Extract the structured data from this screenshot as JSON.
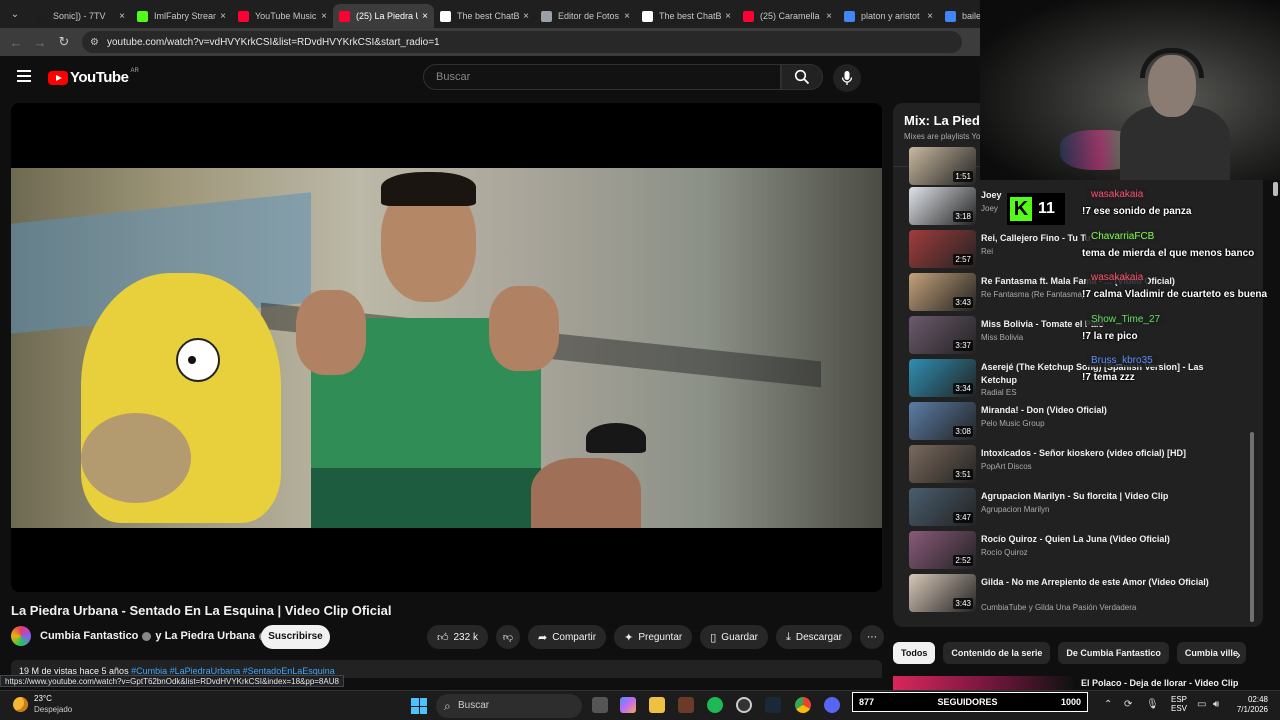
{
  "browser": {
    "tabs": [
      {
        "label": "Sonic]) - 7TV",
        "color": "#1e1e1e"
      },
      {
        "label": "ImlFabry Stream",
        "color": "#53fc18"
      },
      {
        "label": "YouTube Music",
        "color": "#ff0033"
      },
      {
        "label": "(25) La Piedra U",
        "color": "#ff0033"
      },
      {
        "label": "The best ChatB",
        "color": "#ffffff"
      },
      {
        "label": "Editor de Fotos",
        "color": "#9aa0a6"
      },
      {
        "label": "The best ChatB",
        "color": "#ffffff"
      },
      {
        "label": "(25) Caramella",
        "color": "#ff0033"
      },
      {
        "label": "platon y aristot",
        "color": "#4285f4"
      },
      {
        "label": "baile bo",
        "color": "#4285f4"
      }
    ],
    "active_tab_index": 3,
    "url": "youtube.com/watch?v=vdHVYKrkCSI&list=RDvdHVYKrkCSI&start_radio=1",
    "status_url": "https://www.youtube.com/watch?v=GptT62bnOdk&list=RDvdHVYKrkCSI&index=18&pp=8AU8"
  },
  "youtube": {
    "logo_text": "YouTube",
    "country_code": "AR",
    "search_placeholder": "Buscar",
    "video": {
      "title": "La Piedra Urbana - Sentado En La Esquina | Video Clip Oficial",
      "channel": "Cumbia Fantastico",
      "channel_joiner": "y La Piedra Urbana",
      "subscribe_label": "Suscribirse",
      "likes": "232 k",
      "share_label": "Compartir",
      "ask_label": "Preguntar",
      "save_label": "Guardar",
      "download_label": "Descargar",
      "views_date": "19 M de vistas  hace 5 años",
      "hashtags": "#Cumbia #LaPiedraUrbana #SentadoEnLaEsquina"
    },
    "playlist": {
      "title": "Mix: La Piedr",
      "subtitle": "Mixes are playlists Yo",
      "items": [
        {
          "title": "",
          "channel": "",
          "duration": "1:51"
        },
        {
          "title": "Joey",
          "channel": "Joey",
          "duration": "3:18"
        },
        {
          "title": "Rei, Callejero Fino - Tu Tu",
          "channel": "Rei",
          "duration": "2:57"
        },
        {
          "title": "Re Fantasma ft. Mala Fama - ... (Video Oficial)",
          "channel": "Re Fantasma (Re Fantasma)",
          "duration": "3:43"
        },
        {
          "title": "Miss Bolivia - Tomate el Palo",
          "channel": "Miss Bolivia",
          "duration": "3:37"
        },
        {
          "title": "Aserejé (The Ketchup Song) [Spanish Version] - Las Ketchup",
          "channel": "Radial ES",
          "duration": "3:34"
        },
        {
          "title": "Miranda! - Don (Video Oficial)",
          "channel": "Pelo Music Group",
          "duration": "3:08"
        },
        {
          "title": "Intoxicados - Señor kioskero (video oficial) [HD]",
          "channel": "PopArt Discos",
          "duration": "3:51"
        },
        {
          "title": "Agrupacion Marilyn - Su florcita | Video Clip",
          "channel": "Agrupacion Marilyn",
          "duration": "3:47"
        },
        {
          "title": "Rocío Quiroz - Quien La Juna (Video Oficial)",
          "channel": "Rocío Quiroz",
          "duration": "2:52"
        },
        {
          "title": "Gilda - No me Arrepiento de este Amor (Video Oficial)",
          "channel": "CumbiaTube y Gilda Una Pasión Verdadera",
          "duration": "3:43"
        }
      ]
    },
    "chips": [
      "Todos",
      "Contenido de la serie",
      "De Cumbia Fantastico",
      "Cumbia ville"
    ],
    "next_video_title": "El Polaco - Deja de llorar - Video Clip"
  },
  "stream_overlay": {
    "kick_viewers": "11",
    "chat": [
      {
        "user": "wasakakaia",
        "user_color": "#ff4d6d",
        "text": "!7 ese sonido de panza"
      },
      {
        "user": "ChavarriaFCB",
        "user_color": "#7dff4d",
        "text": "tema de mierda el que menos banco"
      },
      {
        "user": "wasakakaia",
        "user_color": "#ff4d6d",
        "text": "!7 calma Vladimir de cuarteto es buena"
      },
      {
        "user": "Show_Time_27",
        "user_color": "#5fe05f",
        "text": "!7 la re pico"
      },
      {
        "user": "Bruss_kbro35",
        "user_color": "#5c8cff",
        "text": "!7 tema zzz"
      }
    ],
    "followers_label": "SEGUIDORES",
    "followers_current": "877",
    "followers_goal": "1000"
  },
  "taskbar": {
    "temperature": "23°C",
    "weather": "Despejado",
    "search_placeholder": "Buscar",
    "lang_top": "ESP",
    "lang_bottom": "ESV",
    "time": "02:48",
    "date": "7/1/2026"
  }
}
